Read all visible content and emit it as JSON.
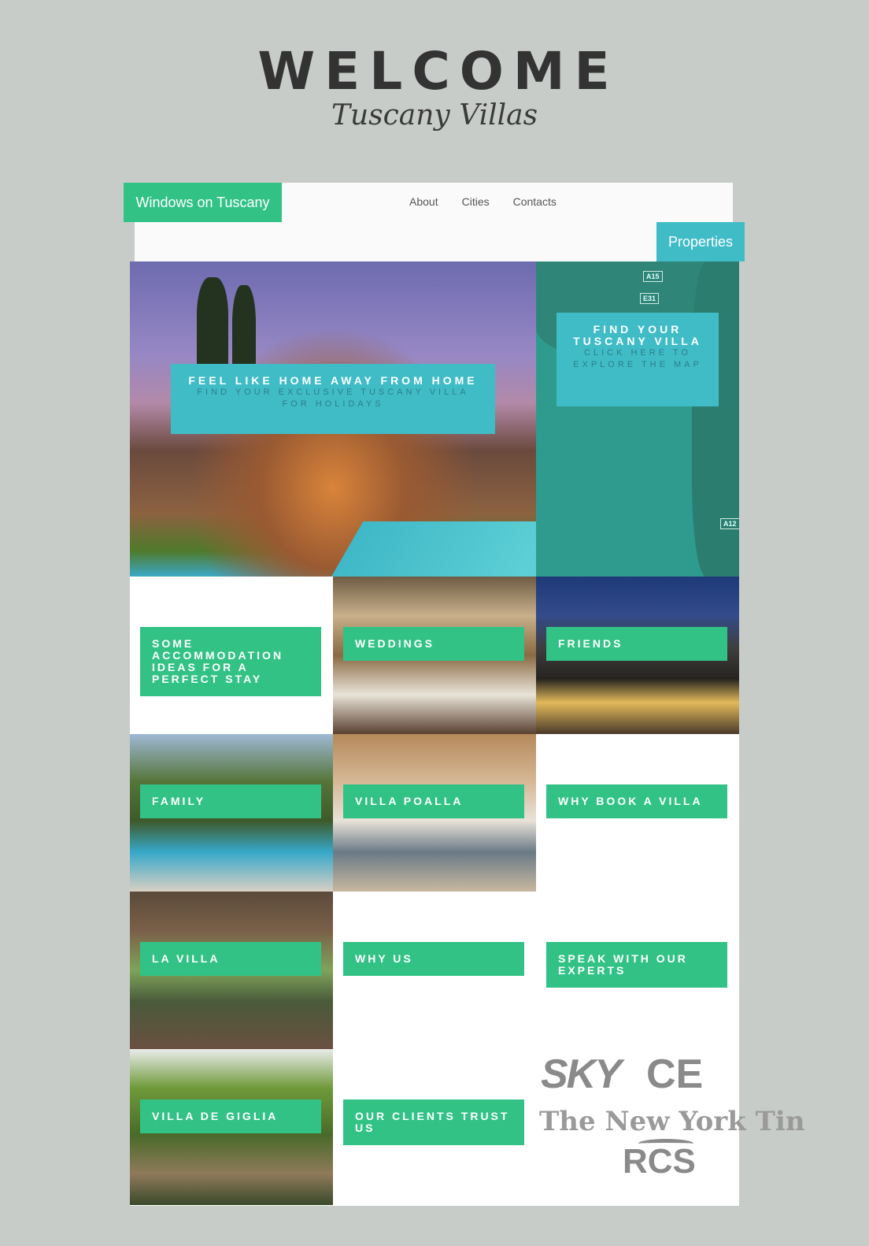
{
  "header": {
    "welcome": "WELCOME",
    "subtitle": "Tuscany Villas"
  },
  "navbar": {
    "brand": "Windows on Tuscany",
    "links": [
      "About",
      "Cities",
      "Contacts"
    ],
    "properties_button": "Properties",
    "accent_green": "#33c286",
    "accent_teal": "#40bcc7"
  },
  "hero": {
    "title": "FEEL LIKE HOME AWAY FROM HOME",
    "subtitle": "FIND YOUR EXCLUSIVE TUSCANY VILLA FOR HOLIDAYS"
  },
  "map_tile": {
    "title": "FIND YOUR TUSCANY VILLA",
    "subtitle": "CLICK HERE TO EXPLORE THE MAP",
    "badges": [
      "A15",
      "E31",
      "A12"
    ]
  },
  "tiles": [
    {
      "label": "SOME ACCOMMODATION IDEAS FOR A PERFECT STAY"
    },
    {
      "label": "WEDDINGS"
    },
    {
      "label": "FRIENDS"
    },
    {
      "label": "FAMILY"
    },
    {
      "label": "VILLA POALLA"
    },
    {
      "label": "WHY BOOK A VILLA"
    },
    {
      "label": "LA VILLA"
    },
    {
      "label": "WHY US"
    },
    {
      "label": "SPEAK WITH OUR EXPERTS"
    },
    {
      "label": "VILLA DE GIGLIA"
    },
    {
      "label": "OUR CLIENTS TRUST US"
    }
  ],
  "press_logos": {
    "sky": "SKY",
    "cbs": "CE",
    "nyt": "The New York Tin",
    "rcs": "RCS"
  }
}
